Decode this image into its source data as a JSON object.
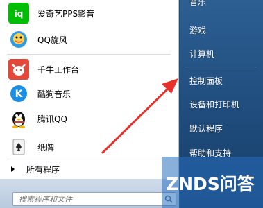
{
  "programs": [
    {
      "label": "爱奇艺PPS影音",
      "icon": "iqiyi-icon"
    },
    {
      "label": "QQ旋风",
      "icon": "qq-whirlwind-icon"
    },
    {
      "label": "千牛工作台",
      "icon": "qianniu-icon"
    },
    {
      "label": "酷狗音乐",
      "icon": "kugou-icon"
    },
    {
      "label": "腾讯QQ",
      "icon": "qq-penguin-icon"
    },
    {
      "label": "纸牌",
      "icon": "solitaire-icon"
    }
  ],
  "all_programs": "所有程序",
  "search": {
    "placeholder": "搜索程序和文件"
  },
  "right_menu": [
    "音乐",
    "游戏",
    "计算机",
    "控制面板",
    "设备和打印机",
    "默认程序",
    "帮助和支持"
  ],
  "watermark": "ZNDS问答",
  "colors": {
    "arrow": "#e8302a",
    "right_panel": "#2d5f93"
  }
}
